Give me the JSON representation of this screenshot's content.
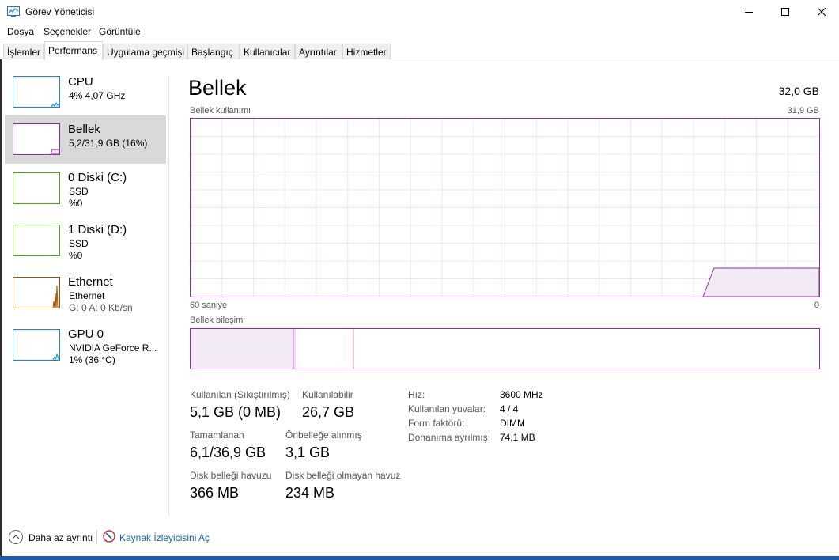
{
  "window": {
    "title": "Görev Yöneticisi"
  },
  "menu": [
    "Dosya",
    "Seçenekler",
    "Görüntüle"
  ],
  "tabs": [
    "İşlemler",
    "Performans",
    "Uygulama geçmişi",
    "Başlangıç",
    "Kullanıcılar",
    "Ayrıntılar",
    "Hizmetler"
  ],
  "active_tab": "Performans",
  "sidebar": {
    "items": [
      {
        "name": "CPU",
        "lines": [
          "4%  4,07 GHz"
        ],
        "color": "#1b87c9"
      },
      {
        "name": "Bellek",
        "lines": [
          "5,2/31,9 GB (16%)"
        ],
        "color": "#8b2fa3",
        "selected": true
      },
      {
        "name": "0 Diski (C:)",
        "lines": [
          "SSD",
          "%0"
        ],
        "color": "#4da60c"
      },
      {
        "name": "1 Diski (D:)",
        "lines": [
          "SSD",
          "%0"
        ],
        "color": "#4da60c"
      },
      {
        "name": "Ethernet",
        "lines": [
          "Ethernet",
          "G: 0  A: 0 Kb/sn"
        ],
        "color": "#a74f01"
      },
      {
        "name": "GPU 0",
        "lines": [
          "NVIDIA GeForce R...",
          "1% (36 °C)"
        ],
        "color": "#1b87c9"
      }
    ]
  },
  "memory": {
    "title": "Bellek",
    "total": "32,0 GB",
    "usage_label": "Bellek kullanımı",
    "usage_max": "31,9 GB",
    "axis_left": "60 saniye",
    "axis_right": "0",
    "composition_label": "Bellek bileşimi",
    "usage_fraction": 0.16,
    "stats": {
      "in_use_label": "Kullanılan (Sıkıştırılmış)",
      "in_use_value": "5,1 GB (0 MB)",
      "available_label": "Kullanılabilir",
      "available_value": "26,7 GB",
      "committed_label": "Tamamlanan",
      "committed_value": "6,1/36,9 GB",
      "cached_label": "Önbelleğe alınmış",
      "cached_value": "3,1 GB",
      "paged_label": "Disk belleği havuzu",
      "paged_value": "366 MB",
      "nonpaged_label": "Disk belleği olmayan havuz",
      "nonpaged_value": "234 MB"
    },
    "details": [
      {
        "key": "Hız:",
        "value": "3600 MHz"
      },
      {
        "key": "Kullanılan yuvalar:",
        "value": "4 / 4"
      },
      {
        "key": "Form faktörü:",
        "value": "DIMM"
      },
      {
        "key": "Donanıma ayrılmış:",
        "value": "74,1 MB"
      }
    ]
  },
  "footer": {
    "less_details": "Daha az ayrıntı",
    "resource_monitor": "Kaynak İzleyicisini Aç"
  }
}
